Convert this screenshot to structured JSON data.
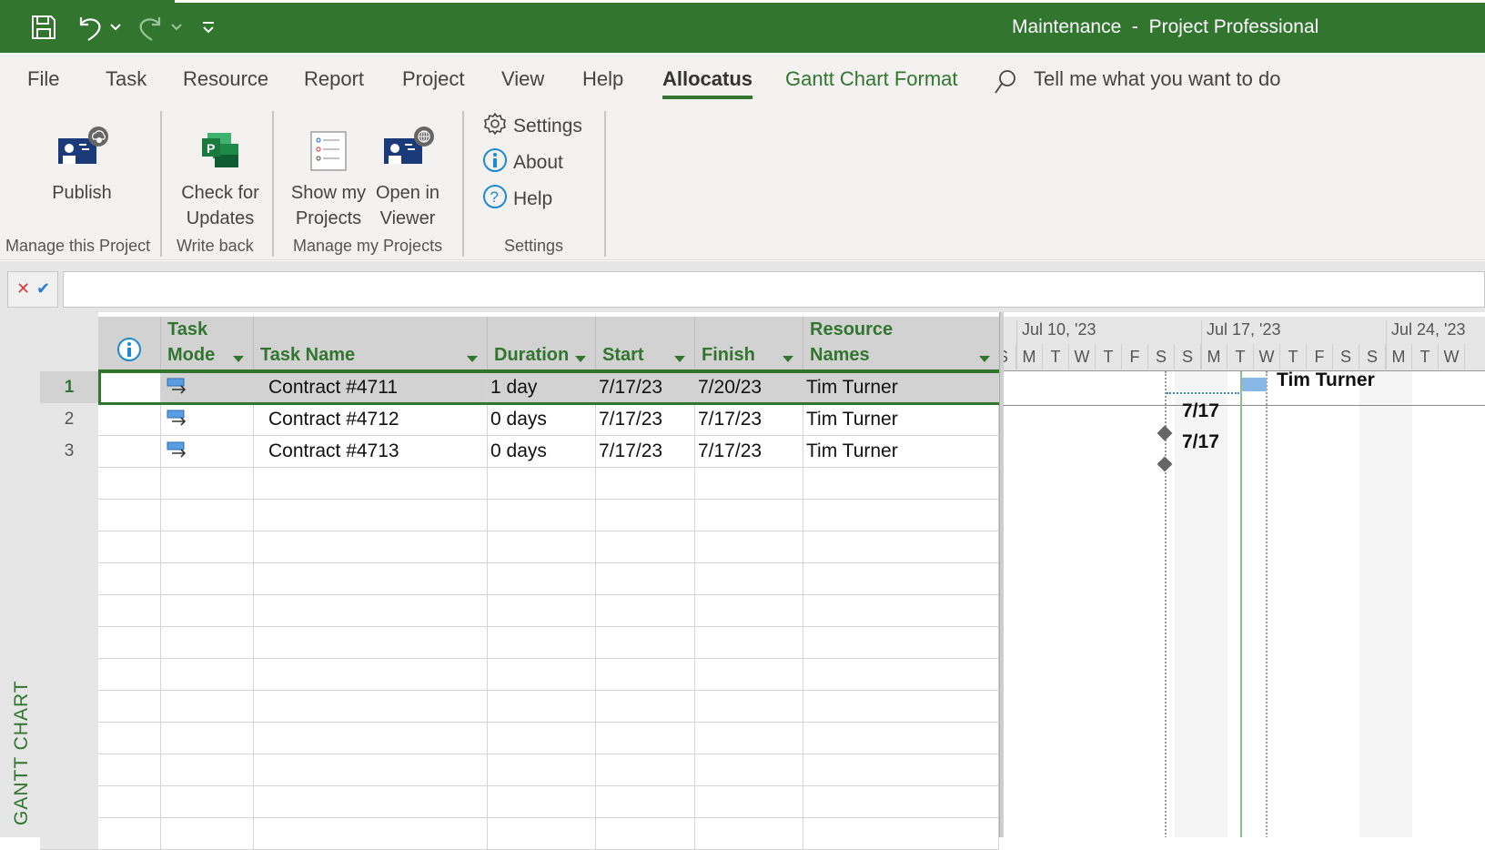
{
  "window": {
    "title": "Maintenance  -  Project Professional",
    "qat": [
      {
        "name": "save-icon"
      },
      {
        "name": "undo-icon"
      },
      {
        "name": "undo-dropdown-icon"
      },
      {
        "name": "redo-icon"
      },
      {
        "name": "redo-dropdown-icon"
      },
      {
        "name": "customize-qat-icon"
      }
    ]
  },
  "tabs": [
    {
      "label": "File"
    },
    {
      "label": "Task"
    },
    {
      "label": "Resource"
    },
    {
      "label": "Report"
    },
    {
      "label": "Project"
    },
    {
      "label": "View"
    },
    {
      "label": "Help"
    },
    {
      "label": "Allocatus",
      "active": true
    },
    {
      "label": "Gantt Chart Format",
      "contextual": true
    }
  ],
  "tellme": {
    "placeholder": "Tell me what you want to do"
  },
  "ribbon": {
    "groups": [
      {
        "label": "Manage this Project",
        "buttons": [
          {
            "label_line1": "Publish",
            "label_line2": "",
            "icon": "publish-icon"
          }
        ]
      },
      {
        "label": "Write back",
        "buttons": [
          {
            "label_line1": "Check for",
            "label_line2": "Updates",
            "icon": "project-app-icon"
          }
        ]
      },
      {
        "label": "Manage my Projects",
        "buttons": [
          {
            "label_line1": "Show my",
            "label_line2": "Projects",
            "icon": "project-list-icon"
          },
          {
            "label_line1": "Open in",
            "label_line2": "Viewer",
            "icon": "open-viewer-icon"
          }
        ]
      },
      {
        "label": "Settings",
        "small_buttons": [
          {
            "label": "Settings",
            "icon": "gear-icon"
          },
          {
            "label": "About",
            "icon": "info-icon"
          },
          {
            "label": "Help",
            "icon": "help-icon"
          }
        ]
      }
    ]
  },
  "entry_bar": {
    "cancel": "✕",
    "confirm": "✔",
    "value": ""
  },
  "view_label": "GANTT CHART",
  "grid": {
    "columns": [
      {
        "label": "",
        "icon": "info-icon"
      },
      {
        "label_line1": "Task",
        "label_line2": "Mode"
      },
      {
        "label_line1": "",
        "label_line2": "Task Name"
      },
      {
        "label_line1": "",
        "label_line2": "Duration"
      },
      {
        "label_line1": "",
        "label_line2": "Start"
      },
      {
        "label_line1": "",
        "label_line2": "Finish"
      },
      {
        "label_line1": "Resource",
        "label_line2": "Names"
      }
    ],
    "rows": [
      {
        "id": "1",
        "task_name": "Contract #4711",
        "duration": "1 day",
        "start": "7/17/23",
        "finish": "7/20/23",
        "resource": "Tim Turner",
        "selected": true
      },
      {
        "id": "2",
        "task_name": "Contract #4712",
        "duration": "0 days",
        "start": "7/17/23",
        "finish": "7/17/23",
        "resource": "Tim Turner"
      },
      {
        "id": "3",
        "task_name": "Contract #4713",
        "duration": "0 days",
        "start": "7/17/23",
        "finish": "7/17/23",
        "resource": "Tim Turner"
      }
    ]
  },
  "timescale": {
    "weeks": [
      "Jul 10, '23",
      "Jul 17, '23",
      "Jul 24, '23"
    ],
    "days": [
      "S",
      "M",
      "T",
      "W",
      "T",
      "F",
      "S",
      "S",
      "M",
      "T",
      "W",
      "T",
      "F",
      "S",
      "S",
      "M",
      "T",
      "W"
    ]
  },
  "gantt": {
    "task1_label": "Tim Turner",
    "milestone2_label": "7/17",
    "milestone3_label": "7/17"
  },
  "colors": {
    "accent": "#31752f",
    "bar": "#8ab8e6"
  }
}
